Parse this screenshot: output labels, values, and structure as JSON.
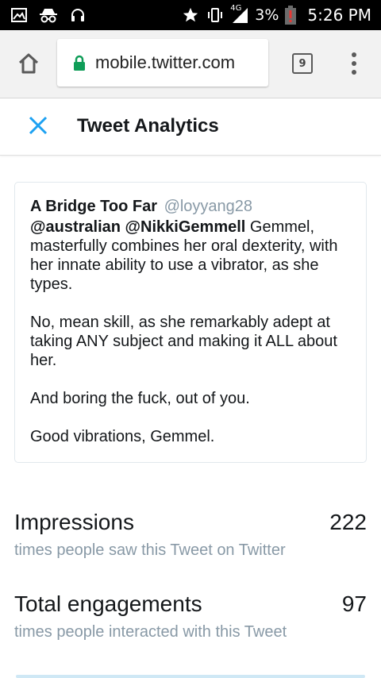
{
  "status_bar": {
    "network": "4G",
    "battery": "3%",
    "time": "5:26 PM",
    "icons": [
      "image-icon",
      "incognito-icon",
      "headset-icon",
      "star-icon",
      "vibrate-icon",
      "signal-icon",
      "battery-low-icon"
    ]
  },
  "browser": {
    "url": "mobile.twitter.com",
    "tab_count": "9",
    "icons": [
      "home-icon",
      "lock-icon",
      "tabs-icon",
      "menu-icon"
    ],
    "lock_color": "#0f9d58"
  },
  "header": {
    "title": "Tweet Analytics",
    "close_color": "#1da1f2"
  },
  "tweet": {
    "author_name": "A Bridge Too Far",
    "author_handle": "@loyyang28",
    "mention_1": "@australian",
    "mention_2": "@NikkiGemmell",
    "paragraph_1_rest": " Gemmel, masterfully combines her oral dexterity, with her innate ability to use a vibrator, as she types.",
    "paragraph_2": "No, mean skill, as she remarkably adept at taking ANY subject and making it ALL about her.",
    "paragraph_3": "And boring the fuck, out of you.",
    "paragraph_4": "Good vibrations, Gemmel."
  },
  "metrics": [
    {
      "label": "Impressions",
      "value": "222",
      "description": "times people saw this Tweet on Twitter"
    },
    {
      "label": "Total engagements",
      "value": "97",
      "description": "times people interacted with this Tweet"
    }
  ]
}
